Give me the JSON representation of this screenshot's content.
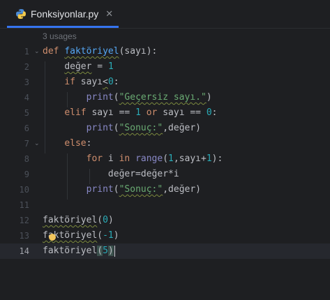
{
  "tab": {
    "title": "Fonksiyonlar.py",
    "close_icon": "close-icon",
    "file_icon": "python-icon"
  },
  "editor": {
    "usages": "3 usages",
    "current_line": 14,
    "lines": [
      {
        "n": "1",
        "fold": "⌄"
      },
      {
        "n": "2"
      },
      {
        "n": "3"
      },
      {
        "n": "4"
      },
      {
        "n": "5"
      },
      {
        "n": "6"
      },
      {
        "n": "7",
        "fold": "⌄"
      },
      {
        "n": "8"
      },
      {
        "n": "9"
      },
      {
        "n": "10"
      },
      {
        "n": "11"
      },
      {
        "n": "12"
      },
      {
        "n": "13"
      },
      {
        "n": "14"
      }
    ],
    "tokens": {
      "l1_def": "def",
      "l1_name": "faktöriyel",
      "l1_params": "(sayı):",
      "l2_var": "değer",
      "l2_eq": " = ",
      "l2_num": "1",
      "l3_if": "if",
      "l3_cond": " sayı",
      "l3_lt": "<",
      "l3_num": "0",
      "l3_colon": ":",
      "l4_print": "print",
      "l4_open": "(",
      "l4_str": "\"Geçersiz sayı.\"",
      "l4_close": ")",
      "l5_elif": "elif",
      "l5_a": " sayı == ",
      "l5_n1": "1",
      "l5_or": " or ",
      "l5_b": "sayı == ",
      "l5_n0": "0",
      "l5_colon": ":",
      "l6_print": "print",
      "l6_open": "(",
      "l6_str": "\"Sonuç:\"",
      "l6_rest": ",değer)",
      "l7_else": "else",
      "l7_colon": ":",
      "l8_for": "for",
      "l8_i": " i ",
      "l8_in": "in",
      "l8_sp": " ",
      "l8_range": "range",
      "l8_open": "(",
      "l8_n1": "1",
      "l8_mid": ",sayı+",
      "l8_n2": "1",
      "l8_close": "):",
      "l9_code": "değer=değer*i",
      "l10_print": "print",
      "l10_open": "(",
      "l10_str": "\"Sonuç:\"",
      "l10_rest": ",değer)",
      "l12_name": "faktöriyel",
      "l12_open": "(",
      "l12_num": "0",
      "l12_close": ")",
      "l13_name": "faktöriyel",
      "l13_open": "(",
      "l13_num": "-1",
      "l13_close": ")",
      "l14_name": "faktöriyel",
      "l14_open": "(",
      "l14_num": "5",
      "l14_close": ")"
    }
  },
  "colors": {
    "background": "#1e1f22",
    "keyword": "#cf8e6d",
    "function": "#56a8f5",
    "number": "#2aacb8",
    "string": "#6aab73",
    "builtin": "#8888c6",
    "tab_accent": "#3574f0"
  }
}
